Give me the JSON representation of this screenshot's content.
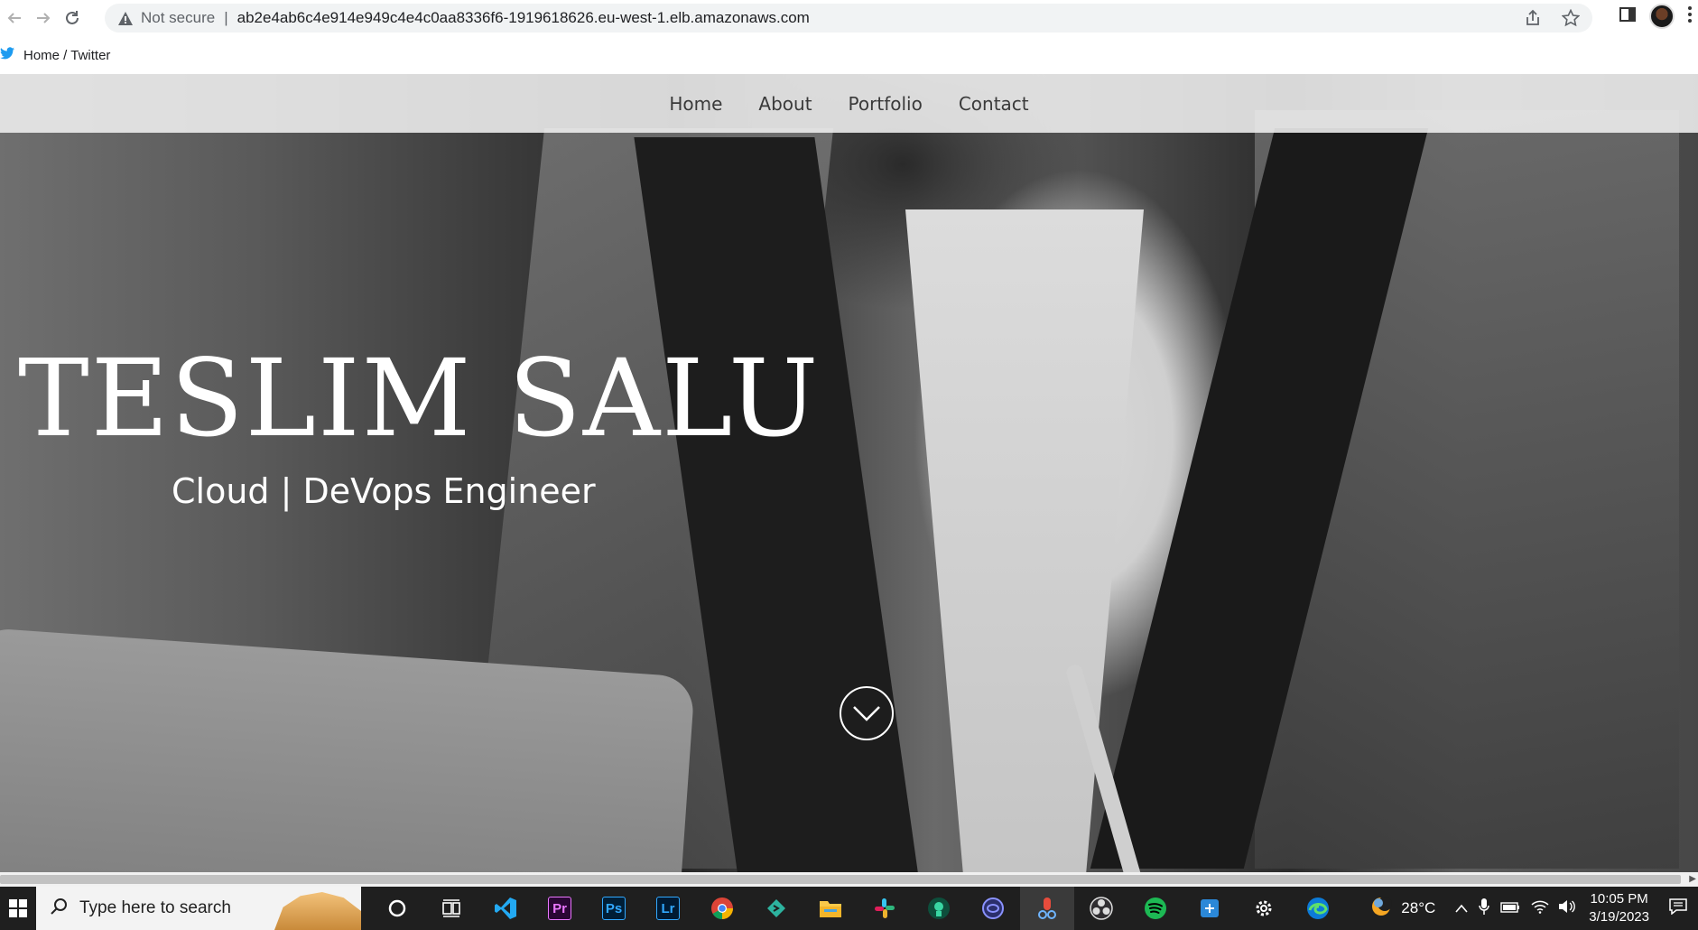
{
  "browser": {
    "security_label": "Not secure",
    "url": "ab2e4ab6c4e914e949c4e4c0aa8336f6-1919618626.eu-west-1.elb.amazonaws.com",
    "icons": [
      "back-icon",
      "forward-icon",
      "reload-icon",
      "warning-icon",
      "share-icon",
      "star-icon",
      "side-panel-icon",
      "profile-avatar",
      "more-icon"
    ]
  },
  "bookmarks": [
    {
      "label": "Home / Twitter",
      "icon": "twitter-icon"
    }
  ],
  "site": {
    "nav": [
      {
        "label": "Home"
      },
      {
        "label": "About"
      },
      {
        "label": "Portfolio"
      },
      {
        "label": "Contact"
      }
    ],
    "hero_name": "TESLIM SALU",
    "hero_subtitle": "Cloud | DeVops Engineer"
  },
  "taskbar": {
    "search_placeholder": "Type here to search",
    "apps": [
      "cortana-icon",
      "task-view-icon",
      "vscode-icon",
      "premiere-icon",
      "photoshop-icon",
      "lightroom-icon",
      "chrome-icon",
      "git-icon",
      "file-explorer-icon",
      "slack-icon",
      "app-icon",
      "app-icon-2",
      "app-icon-3",
      "obs-icon",
      "spotify-icon",
      "app-icon-4",
      "settings-icon",
      "edge-icon"
    ],
    "weather": "28°C",
    "time": "10:05 PM",
    "date": "3/19/2023"
  },
  "colors": {
    "photoshop": "#31a8ff",
    "premiere": "#ea77ff",
    "lightroom": "#31a8ff",
    "spotify": "#1db954",
    "vscode": "#23a9f2",
    "twitter": "#1d9bf0"
  }
}
